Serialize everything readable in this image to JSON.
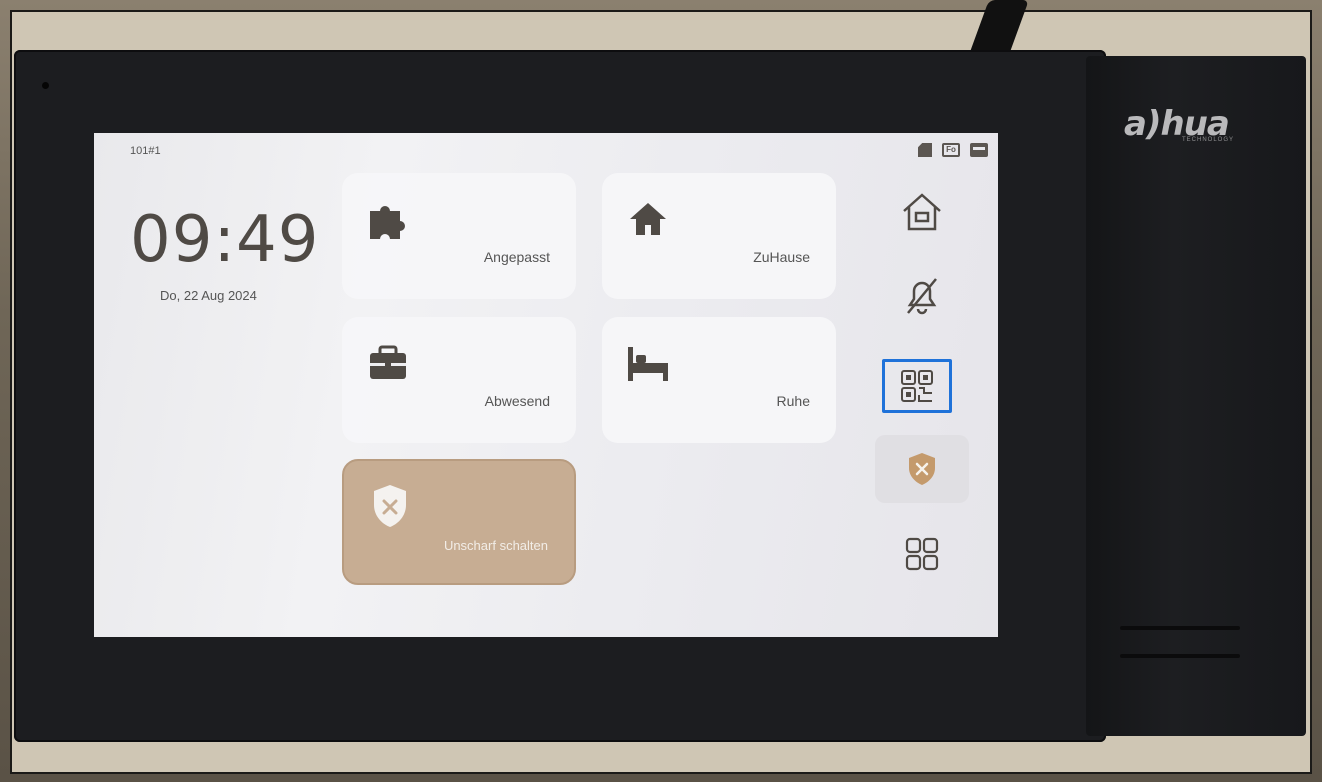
{
  "brand": {
    "name": "a)hua",
    "sub": "TECHNOLOGY"
  },
  "status": {
    "room_id": "101#1",
    "net_icon_text": "Fo"
  },
  "clock": {
    "time": "09:49",
    "date": "Do, 22 Aug 2024"
  },
  "modes": [
    {
      "label": "Angepasst",
      "icon": "puzzle-icon"
    },
    {
      "label": "ZuHause",
      "icon": "home-icon"
    },
    {
      "label": "Abwesend",
      "icon": "briefcase-icon"
    },
    {
      "label": "Ruhe",
      "icon": "bed-icon"
    }
  ],
  "disarm": {
    "label": "Unscharf schalten",
    "icon": "shield-x-icon"
  },
  "sidebar": [
    {
      "name": "home-outline-icon"
    },
    {
      "name": "bell-off-icon"
    },
    {
      "name": "qr-code-icon",
      "active": true
    },
    {
      "name": "shield-x-icon"
    },
    {
      "name": "apps-grid-icon"
    }
  ],
  "colors": {
    "icon": "#4f4a45",
    "disarm_tile": "#c7ad93",
    "shield": "#c49a6c",
    "active_border": "#1f72d9"
  }
}
